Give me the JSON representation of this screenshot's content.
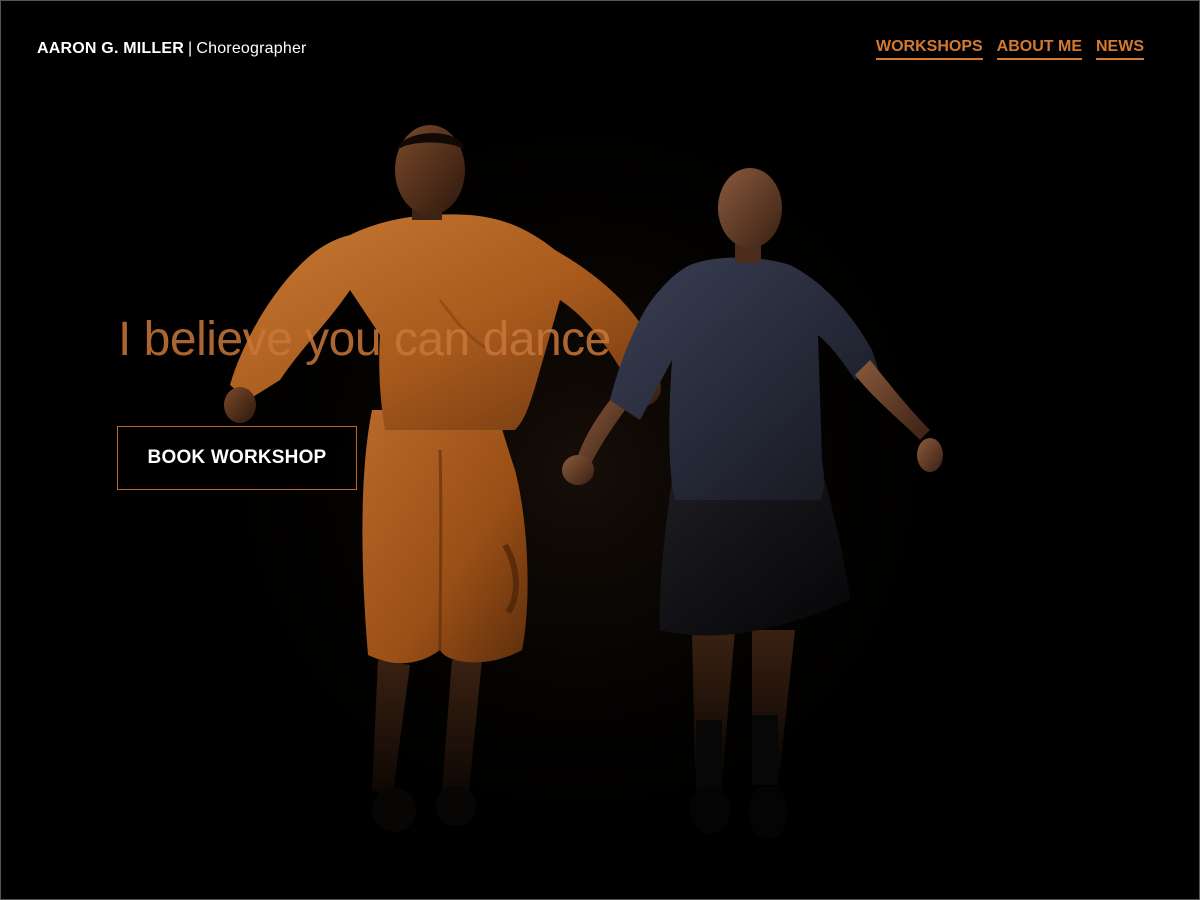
{
  "header": {
    "brand_name": "AARON G. MILLER",
    "brand_separator": "|",
    "brand_role": "Choreographer",
    "nav": [
      {
        "label": "WORKSHOPS"
      },
      {
        "label": "ABOUT ME"
      },
      {
        "label": "NEWS"
      }
    ]
  },
  "hero": {
    "tagline": "I believe you can dance",
    "cta_label": "BOOK WORKSHOP",
    "image_icon": "dancers-photo"
  },
  "colors": {
    "accent": "#d4792f",
    "background": "#000000",
    "text": "#ffffff"
  }
}
